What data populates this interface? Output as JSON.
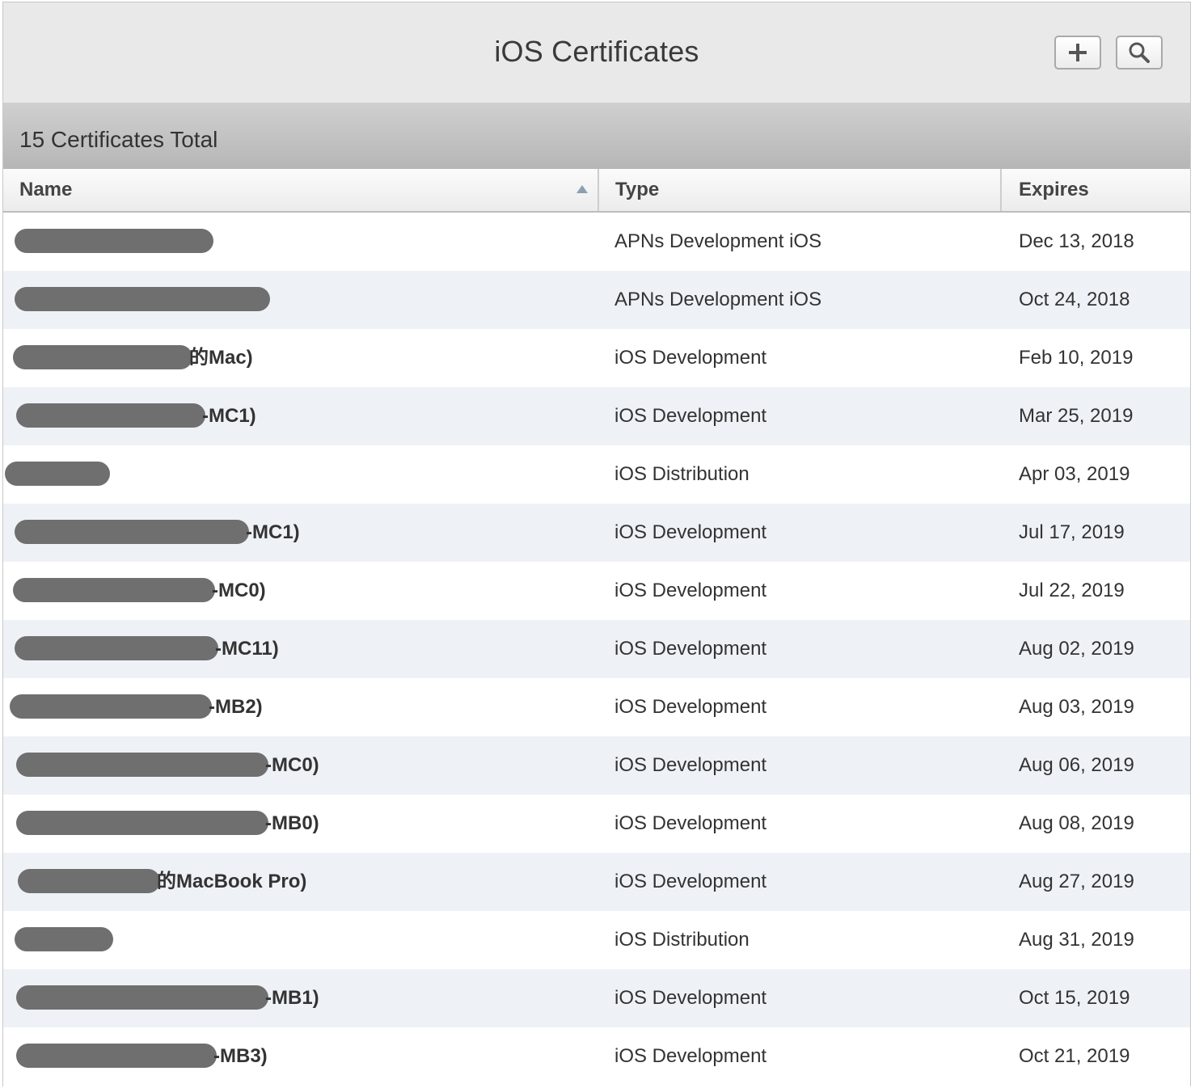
{
  "header": {
    "title": "iOS Certificates",
    "add_icon": "plus-icon",
    "search_icon": "search-icon"
  },
  "summary": {
    "count_label": "15 Certificates Total"
  },
  "columns": {
    "name": "Name",
    "type": "Type",
    "expires": "Expires"
  },
  "sort": {
    "column": "Name",
    "direction": "ascending"
  },
  "colors": {
    "row_alt": "#eef2f7",
    "redaction": "#6f6f6f",
    "header_bar": "#e9e9e9"
  },
  "rows": [
    {
      "name_suffix": "",
      "type": "APNs Development iOS",
      "expires": "Dec 13, 2018"
    },
    {
      "name_suffix": "",
      "type": "APNs Development iOS",
      "expires": "Oct 24, 2018"
    },
    {
      "name_suffix": "的Mac)",
      "type": "iOS Development",
      "expires": "Feb 10, 2019"
    },
    {
      "name_suffix": "-MC1)",
      "type": "iOS Development",
      "expires": "Mar 25, 2019"
    },
    {
      "name_suffix": "",
      "type": "iOS Distribution",
      "expires": "Apr 03, 2019"
    },
    {
      "name_suffix": "-MC1)",
      "type": "iOS Development",
      "expires": "Jul 17, 2019"
    },
    {
      "name_suffix": "-MC0)",
      "type": "iOS Development",
      "expires": "Jul 22, 2019"
    },
    {
      "name_suffix": "-MC11)",
      "type": "iOS Development",
      "expires": "Aug 02, 2019"
    },
    {
      "name_suffix": "-MB2)",
      "type": "iOS Development",
      "expires": "Aug 03, 2019"
    },
    {
      "name_suffix": "-MC0)",
      "type": "iOS Development",
      "expires": "Aug 06, 2019"
    },
    {
      "name_suffix": "-MB0)",
      "type": "iOS Development",
      "expires": "Aug 08, 2019"
    },
    {
      "name_suffix": "的MacBook Pro)",
      "type": "iOS Development",
      "expires": "Aug 27, 2019"
    },
    {
      "name_suffix": "",
      "type": "iOS Distribution",
      "expires": "Aug 31, 2019"
    },
    {
      "name_suffix": "-MB1)",
      "type": "iOS Development",
      "expires": "Oct 15, 2019"
    },
    {
      "name_suffix": "-MB3)",
      "type": "iOS Development",
      "expires": "Oct 21, 2019"
    }
  ]
}
